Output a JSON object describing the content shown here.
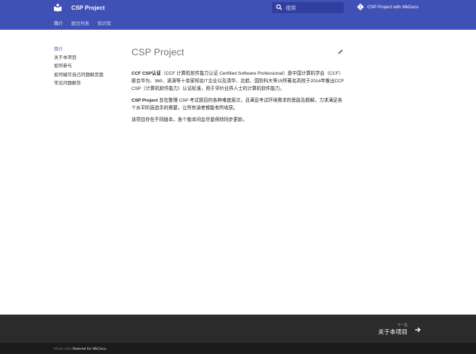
{
  "header": {
    "title": "CSP Project",
    "search_placeholder": "搜索",
    "repo": "CSP Project with MkDocs"
  },
  "tabs": [
    {
      "label": "简介",
      "active": true
    },
    {
      "label": "题目列表"
    },
    {
      "label": "知识库"
    }
  ],
  "nav": [
    {
      "label": "简介",
      "active": true
    },
    {
      "label": "关于本项目"
    },
    {
      "label": "如何参与"
    },
    {
      "label": "如何编写自己的题解页面"
    },
    {
      "label": "常见问题解答"
    }
  ],
  "content": {
    "title": "CSP Project",
    "p1_bold": "CCF CSP认证",
    "p1_rest": "（CCF 计算机软件能力认证 Certified Software Professional）是中国计算机学会（CCF）联合华为、360、滴滴等十余家知名IT企业以及清华、北航、国防科大等15所著名高校于2014年推出CCF CSP（计算机软件能力）认证标准，用于评价业界人士的计算机软件能力。",
    "p2_bold": "CSP Project",
    "p2_rest": " 旨在整理 CSP 考试题目的各种难度层次，且满足考试环境需求的思路及题解，力求满足各个水平阶层选手的需要，让所有读者都能有所收获。",
    "p3": "该项目存在不同版本，各个版本间会尽量保持同步更新。"
  },
  "footer": {
    "next_label": "下一页",
    "next_title": "关于本项目",
    "made_with": "Made with ",
    "made_with_link": "Material for MkDocs"
  }
}
